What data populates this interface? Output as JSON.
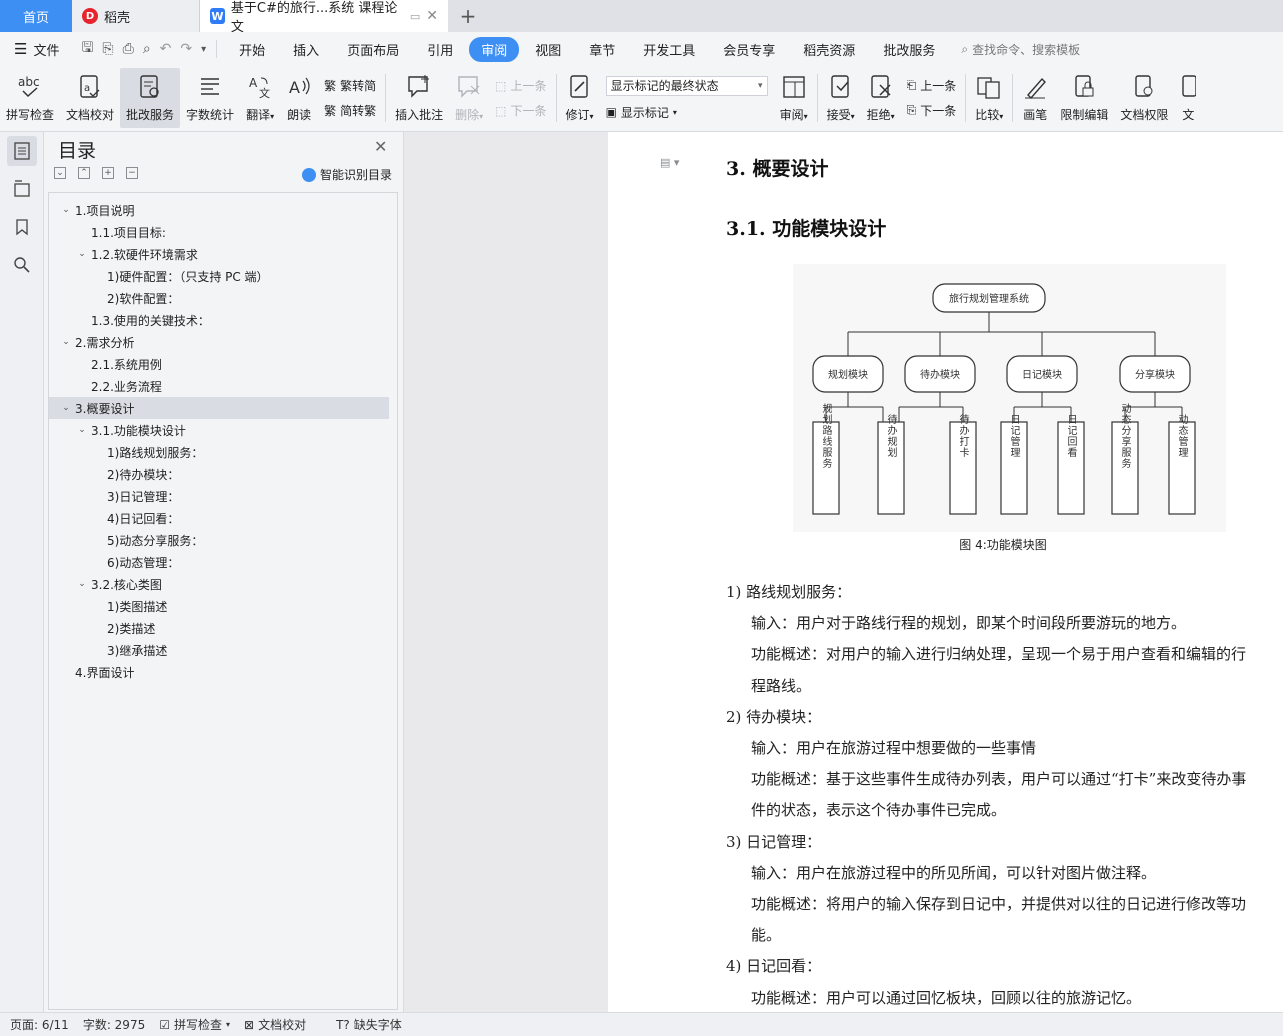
{
  "tabs": {
    "home": "首页",
    "daoke": "稻壳",
    "doc": "基于C#的旅行...系统 课程论文"
  },
  "menu": {
    "file": "文件",
    "items": [
      "开始",
      "插入",
      "页面布局",
      "引用",
      "审阅",
      "视图",
      "章节",
      "开发工具",
      "会员专享",
      "稻壳资源",
      "批改服务"
    ],
    "active": "审阅",
    "search": "查找命令、搜索模板"
  },
  "ribbon": {
    "spell": "拼写检查",
    "proof": "文档校对",
    "correct": "批改服务",
    "wordcount": "字数统计",
    "translate": "翻译",
    "read": "朗读",
    "trad": "繁转简",
    "simp": "简转繁",
    "insert_comment": "插入批注",
    "delete": "删除",
    "prev": "上一条",
    "next": "下一条",
    "revise": "修订",
    "markup_state": "显示标记的最终状态",
    "show_markup": "显示标记",
    "review": "审阅",
    "accept": "接受",
    "reject": "拒绝",
    "prev2": "上一条",
    "next2": "下一条",
    "compare": "比较",
    "pen": "画笔",
    "restrict": "限制编辑",
    "permission": "文档权限",
    "more": "文"
  },
  "toc": {
    "title": "目录",
    "smart": "智能识别目录",
    "items": [
      {
        "text": "1.项目说明",
        "level": 0,
        "arrow": true
      },
      {
        "text": "1.1.项目目标:",
        "level": 1,
        "arrow": false
      },
      {
        "text": "1.2.软硬件环境需求",
        "level": 1,
        "arrow": true
      },
      {
        "text": "1)硬件配置：（只支持 PC 端）",
        "level": 2,
        "arrow": false
      },
      {
        "text": "2)软件配置：",
        "level": 2,
        "arrow": false
      },
      {
        "text": "1.3.使用的关键技术：",
        "level": 1,
        "arrow": false
      },
      {
        "text": "2.需求分析",
        "level": 0,
        "arrow": true
      },
      {
        "text": "2.1.系统用例",
        "level": 1,
        "arrow": false
      },
      {
        "text": "2.2.业务流程",
        "level": 1,
        "arrow": false
      },
      {
        "text": "3.概要设计",
        "level": 0,
        "arrow": true,
        "selected": true
      },
      {
        "text": "3.1.功能模块设计",
        "level": 1,
        "arrow": true
      },
      {
        "text": "1)路线规划服务：",
        "level": 2,
        "arrow": false
      },
      {
        "text": "2)待办模块：",
        "level": 2,
        "arrow": false
      },
      {
        "text": "3)日记管理：",
        "level": 2,
        "arrow": false
      },
      {
        "text": "4)日记回看：",
        "level": 2,
        "arrow": false
      },
      {
        "text": "5)动态分享服务：",
        "level": 2,
        "arrow": false
      },
      {
        "text": "6)动态管理：",
        "level": 2,
        "arrow": false
      },
      {
        "text": "3.2.核心类图",
        "level": 1,
        "arrow": true
      },
      {
        "text": "1)类图描述",
        "level": 2,
        "arrow": false
      },
      {
        "text": "2)类描述",
        "level": 2,
        "arrow": false
      },
      {
        "text": "3)继承描述",
        "level": 2,
        "arrow": false
      },
      {
        "text": "4.界面设计",
        "level": 0,
        "arrow": false
      }
    ]
  },
  "doc": {
    "h1": "3.  概要设计",
    "h2": "3.1. 功能模块设计",
    "figure": {
      "root": "旅行规划管理系统",
      "modules": [
        "规划模块",
        "待办模块",
        "日记模块",
        "分享模块"
      ],
      "leaves": [
        "规划路线服务",
        "待办规划",
        "待办打卡",
        "日记管理",
        "日记回看",
        "动态分享服务",
        "动态管理"
      ],
      "caption": "图 4:功能模块图"
    },
    "paragraphs": [
      {
        "text": "1)   路线规划服务：",
        "indent": 0
      },
      {
        "text": "输入：用户对于路线行程的规划，即某个时间段所要游玩的地方。",
        "indent": 1
      },
      {
        "text": "功能概述：对用户的输入进行归纳处理，呈现一个易于用户查看和编辑的行",
        "indent": 1
      },
      {
        "text": "程路线。",
        "indent": 1
      },
      {
        "text": "2)   待办模块：",
        "indent": 0
      },
      {
        "text": "输入：用户在旅游过程中想要做的一些事情",
        "indent": 1
      },
      {
        "text": "功能概述：基于这些事件生成待办列表，用户可以通过“打卡”来改变待办事",
        "indent": 1
      },
      {
        "text": "件的状态，表示这个待办事件已完成。",
        "indent": 1
      },
      {
        "text": "3)   日记管理：",
        "indent": 0
      },
      {
        "text": "输入：用户在旅游过程中的所见所闻，可以针对图片做注释。",
        "indent": 1
      },
      {
        "text": "功能概述：将用户的输入保存到日记中，并提供对以往的日记进行修改等功",
        "indent": 1
      },
      {
        "text": "能。",
        "indent": 1
      },
      {
        "text": "4)   日记回看：",
        "indent": 0
      },
      {
        "text": "功能概述：用户可以通过回忆板块，回顾以往的旅游记忆。",
        "indent": 1
      }
    ]
  },
  "status": {
    "page": "页面: 6/11",
    "words": "字数: 2975",
    "spell": "拼写检查",
    "proof": "文档校对",
    "font": "缺失字体"
  },
  "colors": {
    "accent": "#3d8ff3",
    "panel": "#f3f4f6",
    "selected": "#d9dce2"
  }
}
